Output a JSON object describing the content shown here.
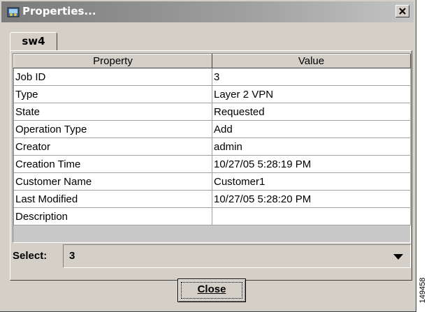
{
  "window": {
    "title": "Properties...",
    "close_glyph": "×",
    "icon": "properties-app-icon"
  },
  "tabs": [
    {
      "label": "sw4",
      "selected": true
    }
  ],
  "table": {
    "columns": [
      "Property",
      "Value"
    ],
    "rows": [
      [
        "Job ID",
        "3"
      ],
      [
        "Type",
        "Layer 2 VPN"
      ],
      [
        "State",
        "Requested"
      ],
      [
        "Operation Type",
        "Add"
      ],
      [
        "Creator",
        "admin"
      ],
      [
        "Creation Time",
        "10/27/05 5:28:19 PM"
      ],
      [
        "Customer Name",
        "Customer1"
      ],
      [
        "Last Modified",
        "10/27/05 5:28:20 PM"
      ],
      [
        "Description",
        ""
      ]
    ]
  },
  "select": {
    "label": "Select:",
    "value": "3"
  },
  "buttons": {
    "close": "Close"
  },
  "side_code": "149458",
  "colors": {
    "dialog_bg": "#d4d0c8",
    "titlebar_start": "#7b7b7b",
    "titlebar_end": "#c4c4c4",
    "cell_bg": "#ffffff"
  }
}
